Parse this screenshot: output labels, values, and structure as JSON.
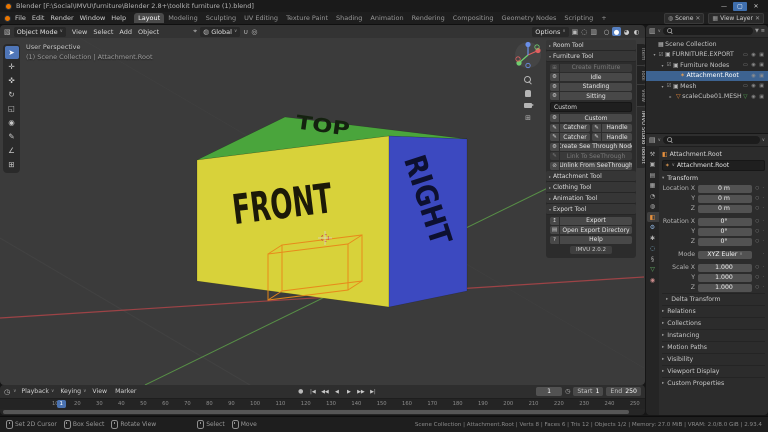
{
  "window": {
    "title": "Blender [F:\\Social\\IMVU\\furniture\\Blender 2.8+\\toolkit furniture (1).blend]",
    "minimize": "—",
    "maximize": "▢",
    "close": "✕"
  },
  "topbar": {
    "menus": [
      "File",
      "Edit",
      "Render",
      "Window",
      "Help"
    ],
    "tabs": [
      {
        "label": "Layout",
        "cls": "active"
      },
      {
        "label": "Modeling"
      },
      {
        "label": "Sculpting"
      },
      {
        "label": "UV Editing"
      },
      {
        "label": "Texture Paint"
      },
      {
        "label": "Shading"
      },
      {
        "label": "Animation"
      },
      {
        "label": "Rendering"
      },
      {
        "label": "Compositing"
      },
      {
        "label": "Geometry Nodes"
      },
      {
        "label": "Scripting"
      },
      {
        "label": "+"
      }
    ],
    "scene": {
      "icon": "◍",
      "label": "Scene",
      "clear": "✕"
    },
    "view_layer": {
      "icon": "▦",
      "label": "View Layer",
      "clear": "✕"
    }
  },
  "vp_header": {
    "editor_icon": "▧",
    "mode": "Object Mode",
    "caret": "∨",
    "menus": [
      "View",
      "Select",
      "Add",
      "Object"
    ],
    "pivot_icon": "⌖",
    "orientation_icon": "◍",
    "orientation": "Global",
    "magnet_icon": "∪",
    "prop_icon": "◎",
    "options": "Options",
    "gizmo_icon": "▣",
    "overlay_icon": "◌",
    "xray_icon": "▥",
    "shading": [
      {
        "name": "wireframe",
        "glyph": "○"
      },
      {
        "name": "solid",
        "glyph": "●",
        "cls": "active"
      },
      {
        "name": "material-preview",
        "glyph": "◕"
      },
      {
        "name": "rendered",
        "glyph": "◐"
      }
    ]
  },
  "toolbar": [
    {
      "name": "tweak-select",
      "glyph": "➤",
      "cls": "active"
    },
    {
      "name": "cursor",
      "glyph": "✛"
    },
    {
      "name": "move",
      "glyph": "✜"
    },
    {
      "name": "rotate",
      "glyph": "↻"
    },
    {
      "name": "scale",
      "glyph": "◱"
    },
    {
      "name": "transform",
      "glyph": "◉"
    },
    {
      "name": "annotate",
      "glyph": "✎"
    },
    {
      "name": "measure",
      "glyph": "∠"
    },
    {
      "name": "add-cube",
      "glyph": "⊞"
    }
  ],
  "viewport": {
    "view_label": "User Perspective",
    "context_label": "(1) Scene Collection | Attachment.Root",
    "cube": {
      "top_label": "TOP",
      "front_label": "FRONT",
      "right_label": "RIGHT",
      "top_color": "#4aa53c",
      "front_color": "#d8d23a",
      "right_color": "#3c49c0"
    },
    "axis_x_color": "#a84448",
    "axis_y_color": "#5d9e49",
    "selection_color": "#e8881a"
  },
  "npanel": {
    "tabs": [
      {
        "label": "Item"
      },
      {
        "label": "Tool"
      },
      {
        "label": "View"
      },
      {
        "label": "IMVU Studio Toolkit",
        "cls": "active"
      }
    ],
    "room_tool": {
      "caret": "▸",
      "label": "Room Tool"
    },
    "furniture_tool": {
      "caret": "▾",
      "label": "Furniture Tool"
    },
    "create_furniture": {
      "icon": "⊞",
      "label": "Create Furniture",
      "cls": "disabled"
    },
    "poses": [
      {
        "icon": "⚙",
        "label": "Idle"
      },
      {
        "icon": "⚙",
        "label": "Standing"
      },
      {
        "icon": "⚙",
        "label": "Sitting"
      }
    ],
    "custom_label": "Custom",
    "custom_button": {
      "icon": "⚙",
      "label": "Custom"
    },
    "pair_rows": [
      {
        "cls": "disabled",
        "a_icon": "✎",
        "a": "Catcher",
        "b_icon": "✎",
        "b": "Handle"
      },
      {
        "cls": "",
        "a_icon": "✎",
        "a": "Catcher",
        "b_icon": "✎",
        "b": "Handle"
      }
    ],
    "see_through": [
      {
        "icon": "⚙",
        "label": "Create See Through Node",
        "cls": ""
      },
      {
        "icon": "✎",
        "label": "Link To SeeThrough",
        "cls": "disabled"
      },
      {
        "icon": "⊘",
        "label": "Unlink From SeeThrough",
        "cls": ""
      }
    ],
    "collapsed": [
      {
        "caret": "▸",
        "label": "Attachment Tool"
      },
      {
        "caret": "▸",
        "label": "Clothing Tool"
      },
      {
        "caret": "▸",
        "label": "Animation Tool"
      }
    ],
    "export_tool": {
      "caret": "▾",
      "label": "Export Tool"
    },
    "export_buttons": [
      {
        "icon": "↥",
        "label": "Export"
      },
      {
        "icon": "▤",
        "label": "Open Export Directory"
      },
      {
        "icon": "?",
        "label": "Help"
      }
    ],
    "version": "IMVU 2.0.2"
  },
  "outliner": {
    "editor_icon": "▥",
    "funnel_icon": "▼",
    "filter_icon": "≡",
    "rows": [
      {
        "style": "padding-left:4px",
        "icon": "▦",
        "label": "Scene Collection",
        "right": ""
      },
      {
        "style": "padding-left:6px",
        "caret": "▾",
        "check": "☑",
        "icon": "▣",
        "label": "FURNITURE.EXPORT",
        "right": "▭ ◉ ▣"
      },
      {
        "style": "padding-left:14px",
        "caret": "▾",
        "check": "☑",
        "icon": "▣",
        "label": "Furniture Nodes",
        "right": "▭ ◉ ▣"
      },
      {
        "style": "padding-left:26px",
        "cls": "sel",
        "icon": "✶",
        "icon_style": "color:#e8a054",
        "label": "Attachment.Root",
        "right": "◉ ▣"
      },
      {
        "style": "padding-left:14px",
        "caret": "▾",
        "check": "☑",
        "icon": "▣",
        "label": "Mesh",
        "right": "▭ ◉ ▣"
      },
      {
        "style": "padding-left:22px",
        "caret": "▸",
        "icon": "▽",
        "icon_style": "color:#e8883a",
        "label": "scaleCube01.MESH",
        "extra": "▽",
        "extra_style": "color:#55b555",
        "right": "◉ ▣"
      }
    ]
  },
  "properties": {
    "editor_icon": "▤",
    "caret": "∨",
    "tabs": [
      {
        "name": "tool",
        "glyph": "⚒",
        "style": "color:#b0b0b0"
      },
      {
        "name": "render",
        "glyph": "▣",
        "style": "color:#b0b0b0"
      },
      {
        "name": "output",
        "glyph": "▤",
        "style": "color:#b0b0b0"
      },
      {
        "name": "view-layer",
        "glyph": "▦",
        "style": "color:#b0b0b0"
      },
      {
        "name": "scene",
        "glyph": "◔",
        "style": "color:#b0b0b0"
      },
      {
        "name": "world",
        "glyph": "◍",
        "style": "color:#b0b0b0"
      },
      {
        "name": "object",
        "glyph": "◧",
        "style": "color:#e8913d",
        "cls": "active"
      },
      {
        "name": "modifiers",
        "glyph": "⚙",
        "style": "color:#8fb3dd"
      },
      {
        "name": "particles",
        "glyph": "✱",
        "style": "color:#b0b0b0"
      },
      {
        "name": "physics",
        "glyph": "◌",
        "style": "color:#89c0e0"
      },
      {
        "name": "constraints",
        "glyph": "§",
        "style": "color:#b0b0b0"
      },
      {
        "name": "object-data",
        "glyph": "▽",
        "style": "color:#6bbf6b"
      },
      {
        "name": "material",
        "glyph": "◉",
        "style": "color:#c98a8a"
      }
    ],
    "breadcrumb": {
      "icon": "◧",
      "label": "Attachment.Root"
    },
    "name_field": {
      "icon": "✶",
      "caret": "∨",
      "label": "Attachment.Root"
    },
    "transform_header": {
      "caret": "▾",
      "label": "Transform"
    },
    "transform_rows": [
      {
        "label": "Location X",
        "value": "0 m",
        "icons": "○ ·"
      },
      {
        "label": "Y",
        "value": "0 m",
        "icons": "○ ·"
      },
      {
        "label": "Z",
        "value": "0 m",
        "icons": "○ ·"
      },
      {
        "label": "Rotation X",
        "value": "0°",
        "icons": "○ ·",
        "cls": "gap"
      },
      {
        "label": "Y",
        "value": "0°",
        "icons": "○ ·"
      },
      {
        "label": "Z",
        "value": "0°",
        "icons": "○ ·"
      },
      {
        "label": "Mode",
        "value": "XYZ Euler",
        "caret": "∨",
        "icons": "·",
        "cls": "gap"
      },
      {
        "label": "Scale X",
        "value": "1.000",
        "icons": "○ ·",
        "cls": "gap"
      },
      {
        "label": "Y",
        "value": "1.000",
        "icons": "○ ·"
      },
      {
        "label": "Z",
        "value": "1.000",
        "icons": "○ ·"
      }
    ],
    "panels": [
      {
        "caret": "▸",
        "label": "Delta Transform",
        "cls": "inner"
      },
      {
        "caret": "▸",
        "label": "Relations"
      },
      {
        "caret": "▸",
        "label": "Collections"
      },
      {
        "caret": "▸",
        "label": "Instancing"
      },
      {
        "caret": "▸",
        "label": "Motion Paths"
      },
      {
        "caret": "▸",
        "label": "Visibility"
      },
      {
        "caret": "▸",
        "label": "Viewport Display"
      },
      {
        "caret": "▸",
        "label": "Custom Properties"
      }
    ]
  },
  "timeline": {
    "editor_icon": "◷",
    "caret": "∨",
    "menus": [
      {
        "label": "Playback",
        "caret": "∨"
      },
      {
        "label": "Keying",
        "caret": "∨"
      },
      {
        "label": "View"
      },
      {
        "label": "Marker"
      }
    ],
    "record_icon": "●",
    "transport": [
      {
        "name": "jump-to-start",
        "glyph": "|◀"
      },
      {
        "name": "prev-keyframe",
        "glyph": "◀◀"
      },
      {
        "name": "play-reverse",
        "glyph": "◀"
      },
      {
        "name": "play",
        "glyph": "▶"
      },
      {
        "name": "next-keyframe",
        "glyph": "▶▶"
      },
      {
        "name": "jump-to-end",
        "glyph": "▶|"
      }
    ],
    "current_frame": "1",
    "clock_icon": "◷",
    "start_label": "Start",
    "start_value": "1",
    "end_label": "End",
    "end_value": "250",
    "ruler_badge": "1",
    "ticks": [
      "10",
      "20",
      "30",
      "40",
      "50",
      "60",
      "70",
      "80",
      "90",
      "100",
      "110",
      "120",
      "130",
      "140",
      "150",
      "160",
      "170",
      "180",
      "190",
      "200",
      "210",
      "220",
      "230",
      "240",
      "250"
    ]
  },
  "statusbar": {
    "hints": [
      {
        "label": "Set 2D Cursor"
      },
      {
        "label": "Box Select"
      },
      {
        "label": "Rotate View"
      },
      {
        "label": "Select",
        "cls": "gap"
      },
      {
        "label": "Move"
      }
    ],
    "info": "Scene Collection | Attachment.Root | Verts 8 | Faces 6 | Tris 12 | Objects 1/2 | Memory: 27.0 MiB | VRAM: 2.0/8.0 GiB | 2.93.4"
  }
}
